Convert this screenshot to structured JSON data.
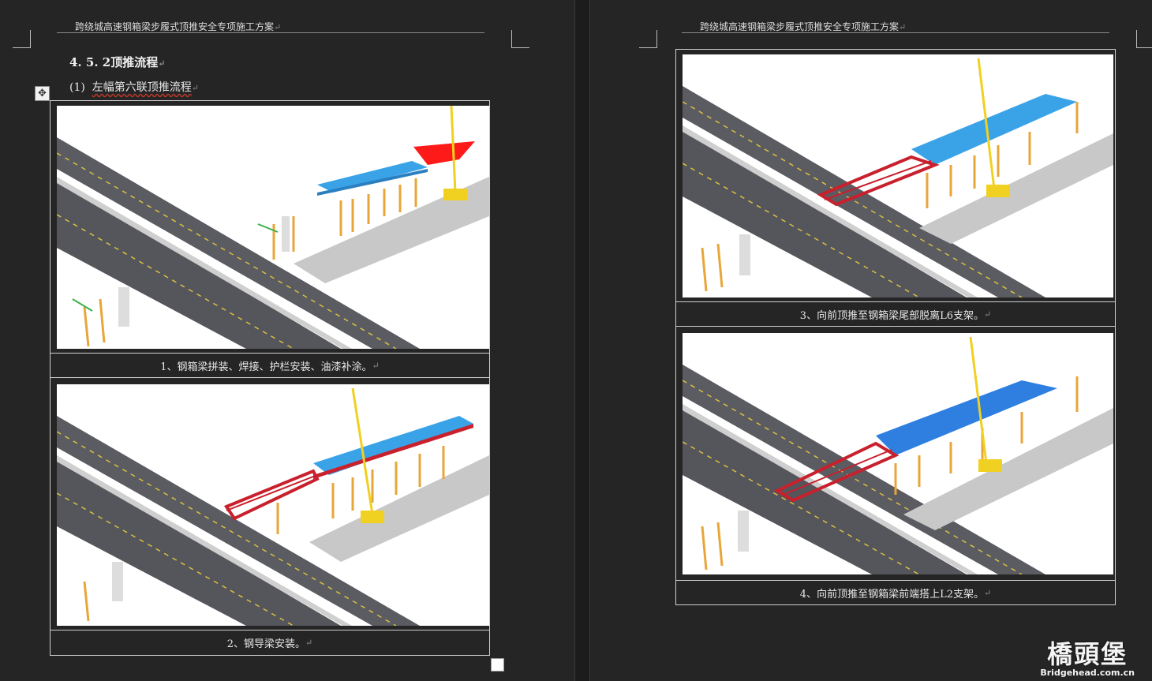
{
  "header_text": "跨绕城高速钢箱梁步履式顶推安全专项施工方案",
  "return_mark": "↵",
  "section_heading": "4. 5. 2顶推流程",
  "sub_heading_num": "(1)",
  "sub_heading_text": "左幅第六联顶推流程",
  "captions": [
    "1、钢箱梁拼装、焊接、护栏安装、油漆补涂。",
    "2、钢导梁安装。",
    "3、向前顶推至钢箱梁尾部脱离L6支架。",
    "4、向前顶推至钢箱梁前端搭上L2支架。"
  ],
  "watermark": {
    "cn": "橋頭堡",
    "url": "Bridgehead.com.cn"
  },
  "colors": {
    "road": "#5b5b62",
    "girder_blue": "#3aa3e8",
    "nose_red": "#c8202c",
    "crane_yellow": "#f0d020",
    "scaffold": "#e8a63a"
  }
}
